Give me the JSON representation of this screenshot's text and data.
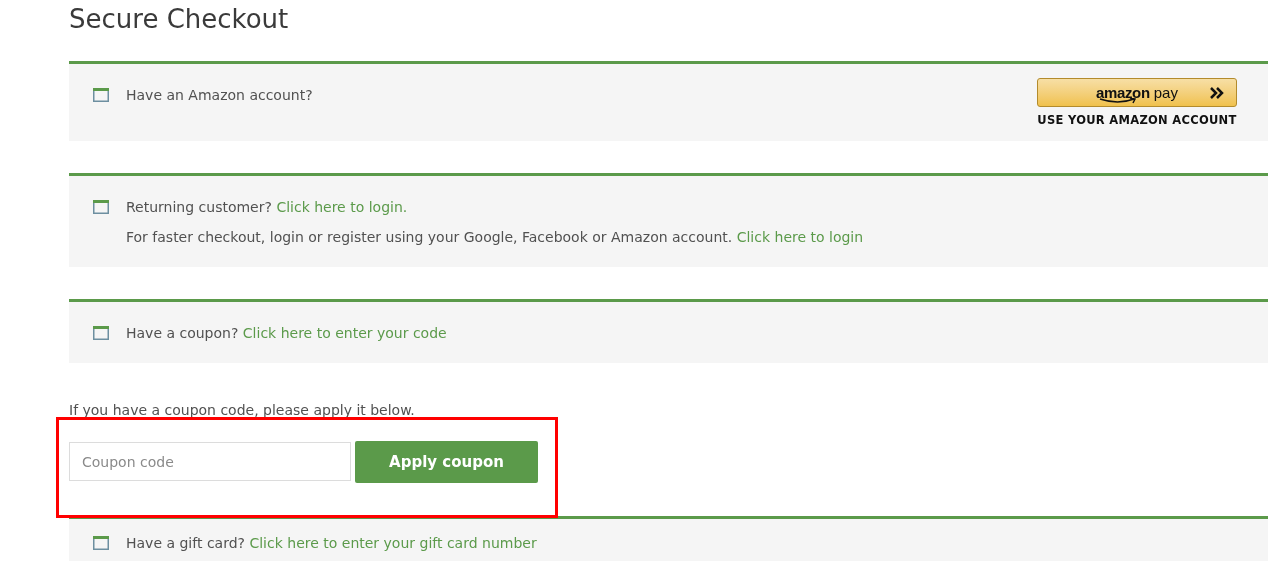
{
  "title": "Secure Checkout",
  "notices": [
    {
      "kind": "amazon",
      "text": "Have an Amazon account?",
      "amazon_button": {
        "brand": "amazon",
        "pay": "pay",
        "caption": "USE YOUR AMAZON ACCOUNT"
      }
    },
    {
      "kind": "login",
      "text": "Returning customer?",
      "link": "Click here to login.",
      "detail": "For faster checkout, login or register using your Google, Facebook or Amazon account.",
      "detail_link": "Click here to login"
    },
    {
      "kind": "coupon",
      "text": "Have a coupon?",
      "link": "Click here to enter your code"
    }
  ],
  "coupon_form": {
    "intro": "If you have a coupon code, please apply it below.",
    "placeholder": "Coupon code",
    "button": "Apply coupon",
    "highlighted": true
  },
  "gift_card": {
    "text": "Have a gift card?",
    "link": "Click here to enter your gift card number"
  }
}
